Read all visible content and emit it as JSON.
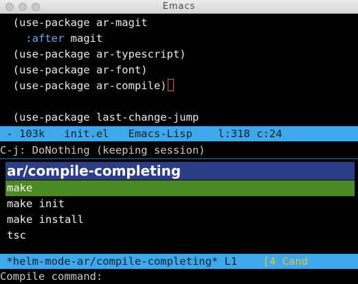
{
  "window": {
    "title": "Emacs",
    "traffic_lights": [
      "close",
      "minimize",
      "zoom"
    ]
  },
  "buffer": {
    "lines": [
      {
        "text": "  (use-package ar-magit"
      },
      {
        "indent": "    ",
        "keyword": ":after",
        "rest": " magit"
      },
      {
        "text": "  (use-package ar-typescript)"
      },
      {
        "text": "  (use-package ar-font)"
      },
      {
        "text": "  (use-package ar-compile)"
      },
      {
        "text": ""
      },
      {
        "text": "  (use-package last-change-jump"
      }
    ]
  },
  "mode_line": {
    "text": " - 103k   init.el   Emacs-Lisp    l:318 c:24   "
  },
  "echo_area": {
    "text": "C-j: DoNothing (keeping session)"
  },
  "helm": {
    "source_header": "ar/compile-completing",
    "candidates": [
      {
        "label": "make",
        "selected": true
      },
      {
        "label": "make init",
        "selected": false
      },
      {
        "label": "make install",
        "selected": false
      },
      {
        "label": "tsc",
        "selected": false
      }
    ],
    "mode_line": {
      "buffer_name": " *helm-mode-ar/compile-completing* L1    ",
      "count_text": "[4 Cand"
    }
  },
  "minibuffer": {
    "prompt": "Compile command: "
  },
  "colors": {
    "modeline_bg": "#3ea8ea",
    "helm_header_bg": "#2c3f86",
    "selection_bg": "#4b8a24",
    "keyword": "#64a8f2",
    "paren_match_box": "#d55a7a"
  }
}
